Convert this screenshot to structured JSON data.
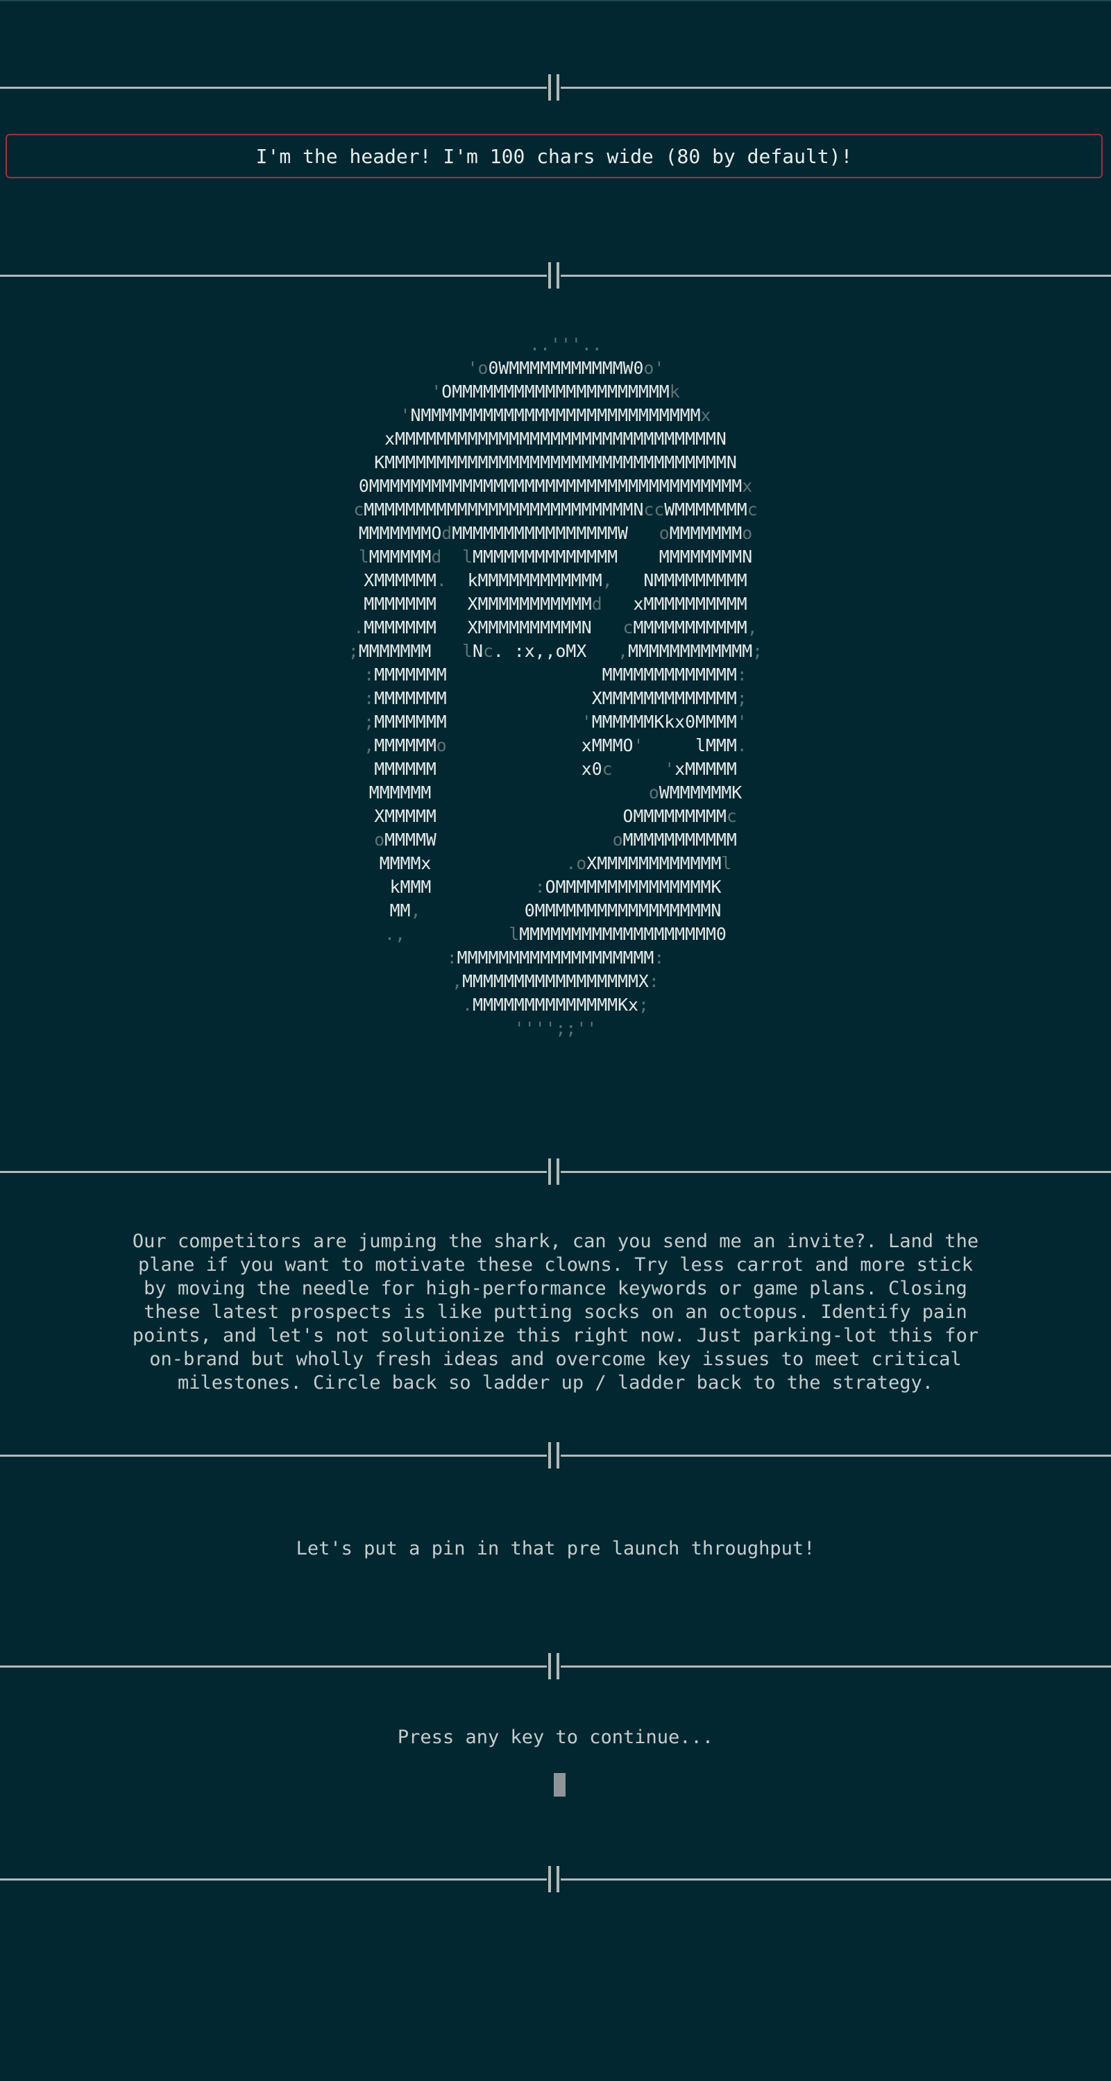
{
  "header": {
    "text": "I'm the header! I'm 100 chars wide (80 by default)!"
  },
  "ascii_art": [
    [
      [
        "  ..'''..",
        1
      ]
    ],
    [
      [
        "  '",
        1
      ],
      [
        "o",
        1
      ],
      [
        "0WMMMMMMMMMMMW0",
        0
      ],
      [
        "o'",
        1
      ]
    ],
    [
      [
        "'",
        1
      ],
      [
        "OMMMMMMMMMMMMMMMMMMMMM",
        0
      ],
      [
        "k",
        1
      ]
    ],
    [
      [
        "'",
        1
      ],
      [
        "NMMMMMMMMMMMMMMMMMMMMMMMMMMM",
        0
      ],
      [
        "x",
        1
      ]
    ],
    [
      [
        "xMMMMMMMMMMMMMMMMMMMMMMMMMMMMMMMN",
        0
      ]
    ],
    [
      [
        "KMMMMMMMMMMMMMMMMMMMMMMMMMMMMMMMMMN",
        0
      ]
    ],
    [
      [
        "0MMMMMMMMMMMMMMMMMMMMMMMMMMMMMMMMMMMM",
        0
      ],
      [
        "x",
        1
      ]
    ],
    [
      [
        "c",
        1
      ],
      [
        "MMMMMMMMMMMMMMMMMMMMMMMMMMN",
        0
      ],
      [
        "cc",
        1
      ],
      [
        "WMMMMMMM",
        0
      ],
      [
        "c",
        1
      ]
    ],
    [
      [
        "MMMMMMMO",
        0
      ],
      [
        "d",
        1
      ],
      [
        "MMMMMMMMMMMMMMMMW   ",
        0
      ],
      [
        "o",
        1
      ],
      [
        "MMMMMMM",
        0
      ],
      [
        "o",
        1
      ]
    ],
    [
      [
        "l",
        1
      ],
      [
        "MMMMMM",
        0
      ],
      [
        "d",
        1
      ],
      [
        "  ",
        0
      ],
      [
        "l",
        1
      ],
      [
        "MMMMMMMMMMMMMM    MMMMMMMMN",
        0
      ]
    ],
    [
      [
        "XMMMMMM",
        0
      ],
      [
        ".",
        1
      ],
      [
        "  kMMMMMMMMMMMM",
        0
      ],
      [
        ",",
        1
      ],
      [
        "   NMMMMMMMMM",
        0
      ]
    ],
    [
      [
        "MMMMMMM   XMMMMMMMMMMM",
        0
      ],
      [
        "d",
        1
      ],
      [
        "   xMMMMMMMMMM",
        0
      ]
    ],
    [
      [
        ".",
        1
      ],
      [
        "MMMMMMM   XMMMMMMMMMMN   ",
        0
      ],
      [
        "c",
        1
      ],
      [
        "MMMMMMMMMMM",
        0
      ],
      [
        ",",
        1
      ]
    ],
    [
      [
        ";",
        1
      ],
      [
        "MMMMMMM   ",
        0
      ],
      [
        "l",
        1
      ],
      [
        "N",
        0
      ],
      [
        "c",
        1
      ],
      [
        ". :x,,oMX   ",
        0
      ],
      [
        ",",
        1
      ],
      [
        "MMMMMMMMMMMM",
        0
      ],
      [
        ";",
        1
      ]
    ],
    [
      [
        ":",
        1
      ],
      [
        "MMMMMMM               MMMMMMMMMMMMM",
        0
      ],
      [
        ":",
        1
      ]
    ],
    [
      [
        ":",
        1
      ],
      [
        "MMMMMMM              XMMMMMMMMMMMMM",
        0
      ],
      [
        ";",
        1
      ]
    ],
    [
      [
        ";",
        1
      ],
      [
        "MMMMMMM             ",
        0
      ],
      [
        "'",
        1
      ],
      [
        "MMMMMMKkx0MMMM",
        0
      ],
      [
        "'",
        1
      ]
    ],
    [
      [
        ",",
        1
      ],
      [
        "MMMMMM",
        0
      ],
      [
        "o",
        1
      ],
      [
        "             xMMMO",
        0
      ],
      [
        "'",
        1
      ],
      [
        "     lMMM",
        0
      ],
      [
        ".",
        1
      ]
    ],
    [
      [
        "MMMMMM              x0",
        0
      ],
      [
        "c",
        1
      ],
      [
        "     ",
        0
      ],
      [
        "'",
        1
      ],
      [
        "xMMMMM",
        0
      ]
    ],
    [
      [
        "MMMMMM                     ",
        0
      ],
      [
        "o",
        1
      ],
      [
        "WMMMMMMK",
        0
      ]
    ],
    [
      [
        "XMMMMM                  OMMMMMMMMM",
        0
      ],
      [
        "c",
        1
      ]
    ],
    [
      [
        "o",
        1
      ],
      [
        "MMMMW                 ",
        0
      ],
      [
        "o",
        1
      ],
      [
        "MMMMMMMMMMM",
        0
      ]
    ],
    [
      [
        "MMMMx",
        0
      ],
      [
        "             .",
        1
      ],
      [
        "o",
        1
      ],
      [
        "XMMMMMMMMMMMM",
        0
      ],
      [
        "l",
        1
      ]
    ],
    [
      [
        "kMMM          ",
        0
      ],
      [
        ":",
        1
      ],
      [
        "OMMMMMMMMMMMMMMMK",
        0
      ]
    ],
    [
      [
        "MM",
        0
      ],
      [
        ",",
        1
      ],
      [
        "          0MMMMMMMMMMMMMMMMMN",
        0
      ]
    ],
    [
      [
        ".,",
        1
      ],
      [
        "          ",
        0
      ],
      [
        "l",
        1
      ],
      [
        "MMMMMMMMMMMMMMMMMMM0",
        0
      ]
    ],
    [
      [
        ":",
        1
      ],
      [
        "MMMMMMMMMMMMMMMMMMM",
        0
      ],
      [
        ":",
        1
      ]
    ],
    [
      [
        ",",
        1
      ],
      [
        "MMMMMMMMMMMMMMMMMX",
        0
      ],
      [
        ":",
        1
      ]
    ],
    [
      [
        ".",
        1
      ],
      [
        "MMMMMMMMMMMMMMKx",
        0
      ],
      [
        ";",
        1
      ]
    ],
    [
      [
        "'''';;''",
        1
      ]
    ]
  ],
  "body": {
    "paragraph": "Our competitors are jumping the shark, can you send me an invite?. Land the\nplane if you want to motivate these clowns. Try less carrot and more stick\nby moving the needle for high-performance keywords or game plans. Closing\nthese latest prospects is like putting socks on an octopus. Identify pain\npoints, and let's not solutionize this right now. Just parking-lot this for\non-brand but wholly fresh ideas and overcome key issues to meet critical\nmilestones. Circle back so ladder up / ladder back to the strategy.",
    "tagline": "Let's put a pin in that pre launch throughput!",
    "prompt": "Press any key to continue..."
  }
}
